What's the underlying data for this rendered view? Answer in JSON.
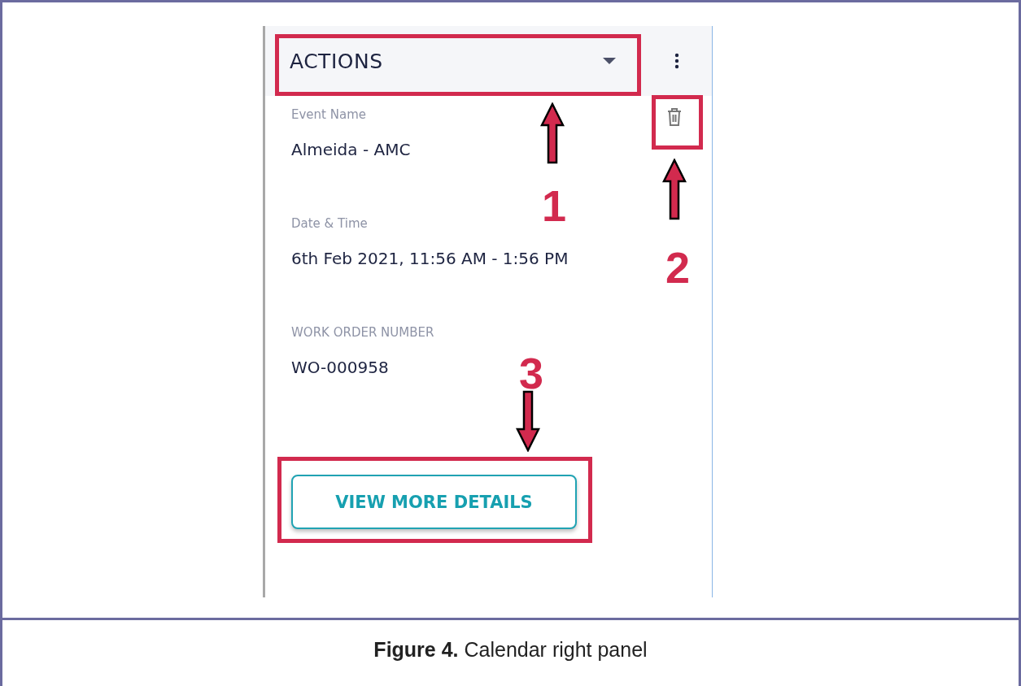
{
  "panel": {
    "header": {
      "title": "ACTIONS"
    },
    "fields": [
      {
        "label": "Event Name",
        "value": "Almeida - AMC"
      },
      {
        "label": "Date & Time",
        "value": "6th Feb 2021, 11:56 AM - 1:56 PM"
      },
      {
        "label": "WORK ORDER NUMBER",
        "value": "WO-000958"
      }
    ],
    "button": "VIEW MORE DETAILS"
  },
  "annotations": [
    {
      "number": "1",
      "kind": "up"
    },
    {
      "number": "2",
      "kind": "up"
    },
    {
      "number": "3",
      "kind": "down"
    }
  ],
  "caption": "**Figure 4.** Calendar right panel"
}
